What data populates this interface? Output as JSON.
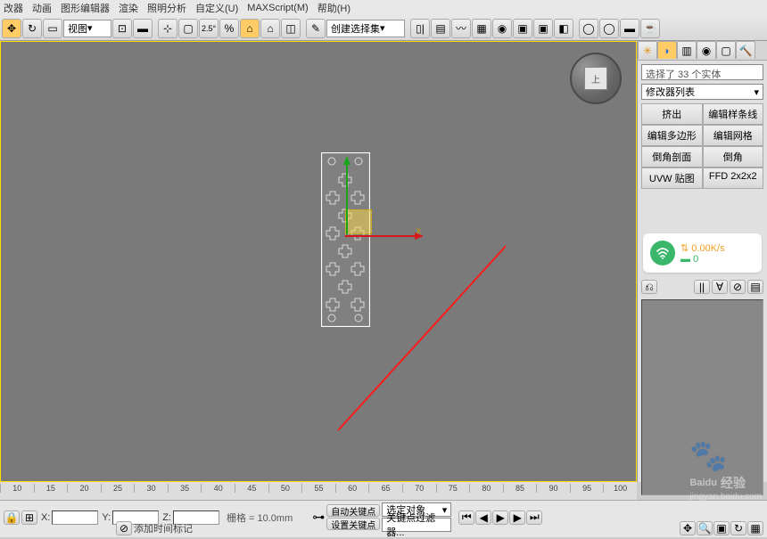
{
  "menu": {
    "items": [
      "改器",
      "动画",
      "图形编辑器",
      "渲染",
      "照明分析",
      "自定义(U)",
      "MAXScript(M)",
      "帮助(H)"
    ]
  },
  "toolbar": {
    "view_dd": "视图",
    "degree": "2.5°",
    "createset": "创建选择集"
  },
  "viewport": {
    "cube_face": "上"
  },
  "gizmo": {
    "x_label": "x"
  },
  "cmdpanel": {
    "selection": "选择了 33 个实体",
    "modlist": "修改器列表",
    "btns": [
      "挤出",
      "编辑样条线",
      "编辑多边形",
      "编辑网格",
      "倒角剖面",
      "倒角",
      "UVW 贴图",
      "FFD 2x2x2"
    ]
  },
  "wifi": {
    "rate": "0.00K/s",
    "count": "0"
  },
  "timeline": {
    "ticks": [
      "10",
      "15",
      "20",
      "25",
      "30",
      "35",
      "40",
      "45",
      "50",
      "55",
      "60",
      "65",
      "70",
      "75",
      "80",
      "85",
      "90",
      "95",
      "100"
    ]
  },
  "status": {
    "timetag": "添加时间标记",
    "X": "X:",
    "Y": "Y:",
    "Z": "Z:",
    "grid": "栅格 = 10.0mm",
    "autokey": "自动关键点",
    "setkey": "设置关键点",
    "selobj": "选定对象",
    "keyfilter": "关键点过滤器..."
  },
  "watermark": {
    "brand": "Baidu",
    "sub_brand": "经验",
    "url": "jingyan.baidu.com"
  }
}
